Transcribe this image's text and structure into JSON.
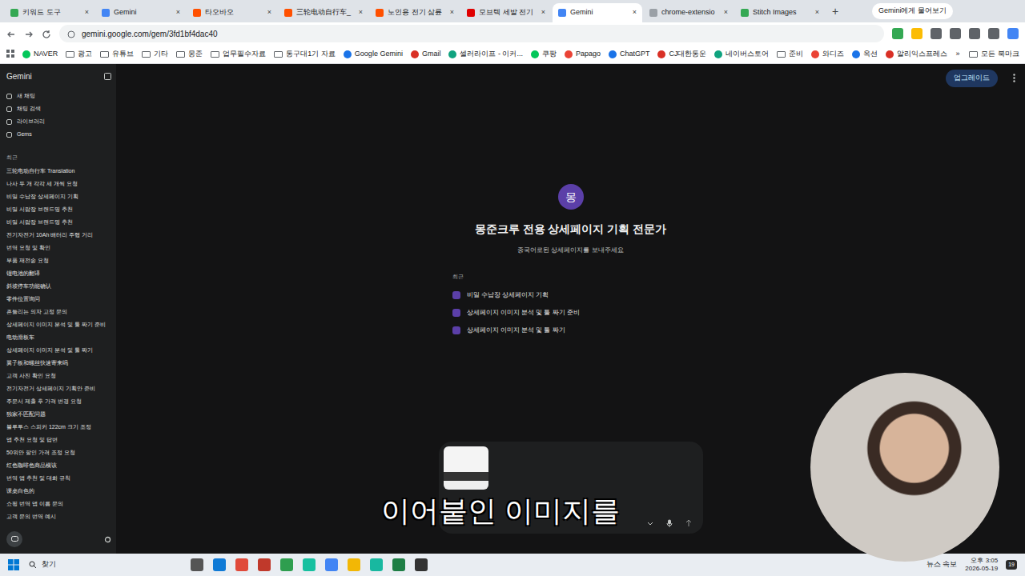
{
  "browser": {
    "tabs": [
      {
        "label": "키워드 도구",
        "selected": false,
        "color": "#34a853"
      },
      {
        "label": "Gemini",
        "selected": false,
        "color": "#4285f4"
      },
      {
        "label": "타오바오",
        "selected": false,
        "color": "#ff5000"
      },
      {
        "label": "三轮电动自行车_",
        "selected": false,
        "color": "#ff5000"
      },
      {
        "label": "노인용 전기 삼륜",
        "selected": false,
        "color": "#ff5000"
      },
      {
        "label": "모브텍 세발 전기",
        "selected": false,
        "color": "#e00000"
      },
      {
        "label": "Gemini",
        "selected": true,
        "color": "#4285f4"
      },
      {
        "label": "chrome-extensio",
        "selected": false,
        "color": "#9aa0a6"
      },
      {
        "label": "Stitch Images",
        "selected": false,
        "color": "#34a853"
      }
    ],
    "close": "×",
    "new_tab": "+",
    "ask_gemini": "Gemini에게 물어보기",
    "address": "gemini.google.com/gem/3fd1bf4dac40",
    "bookmarks": [
      {
        "label": "NAVER",
        "kind": "link"
      },
      {
        "label": "광고",
        "kind": "folder"
      },
      {
        "label": "유튜브",
        "kind": "folder"
      },
      {
        "label": "기타",
        "kind": "folder"
      },
      {
        "label": "몽준",
        "kind": "folder"
      },
      {
        "label": "업무필수자료",
        "kind": "folder"
      },
      {
        "label": "통구대1기 자료",
        "kind": "folder"
      },
      {
        "label": "Google Gemini",
        "kind": "link"
      },
      {
        "label": "Gmail",
        "kind": "link"
      },
      {
        "label": "셀러라이프 - 이커...",
        "kind": "link"
      },
      {
        "label": "쿠팡",
        "kind": "link"
      },
      {
        "label": "Papago",
        "kind": "link"
      },
      {
        "label": "ChatGPT",
        "kind": "link"
      },
      {
        "label": "CJ대한통운",
        "kind": "link"
      },
      {
        "label": "네이버스토어",
        "kind": "link"
      },
      {
        "label": "준비",
        "kind": "folder"
      },
      {
        "label": "와디즈",
        "kind": "link"
      },
      {
        "label": "옥션",
        "kind": "link"
      },
      {
        "label": "알리익스프레스",
        "kind": "link"
      }
    ],
    "overflow": "»",
    "all_bookmarks": "모든 북마크"
  },
  "sidebar": {
    "title": "Gemini",
    "nav": [
      "새 채팅",
      "채팅 검색",
      "라이브러리",
      "Gems"
    ],
    "recent_label": "최근",
    "recent": [
      "三轮电动自行车 Translation",
      "나사 두 개 각각 세 개씩 요청",
      "비밀 수납장 상세페이지 기획",
      "비밀 서랍장 브랜드명 추천",
      "비밀 서랍장 브랜드명 추천",
      "전기자전거 10Ah 배터리 주행 거리",
      "번역 요청 및 확인",
      "부품 재전송 요청",
      "锂电池的翻译",
      "斜坡停车功能确认",
      "零件位置询问",
      "흔들리는 의자 고정 문의",
      "상세페이지 이미지 분석 및 툴 짜기 준비",
      "电动滑板车",
      "상세페이지 이미지 분석 및 툴 짜기",
      "翼子板和螺丝快速寄来吗",
      "고객 사진 확인 요청",
      "전기자전거 상세페이지 기획안 준비",
      "주문서 제출 후 가격 변경 요청",
      "独家不匹配问题",
      "블루투스 스피커 122cm 크기 조정",
      "앱 추천 요청 및 답변",
      "50위안 할인 가격 조정 요청",
      "红色咖啡色商品横该",
      "번역 앱 추천 및 대화 규칙",
      "课桌白色的",
      "쇼핑 번역 앱 이름 문의",
      "고객 문의 번역 예시"
    ]
  },
  "header": {
    "upgrade": "업그레이드"
  },
  "gem": {
    "avatar": "몽",
    "title": "몽준크루 전용 상세페이지 기획 전문가",
    "subtitle": "중국어로된 상세페이지를 보내주세요",
    "recent_label": "최근",
    "recent": [
      "비밀 수납장 상세페이지 기획",
      "상세페이지 이미지 분석 및 툴 짜기 준비",
      "상세페이지 이미지 분석 및 툴 짜기"
    ]
  },
  "caption": "이어붙인 이미지를",
  "taskbar": {
    "search": "찾기",
    "news": "뉴스 속보",
    "time": "오후 3:05",
    "date": "2026-05-19",
    "badge": "19"
  }
}
